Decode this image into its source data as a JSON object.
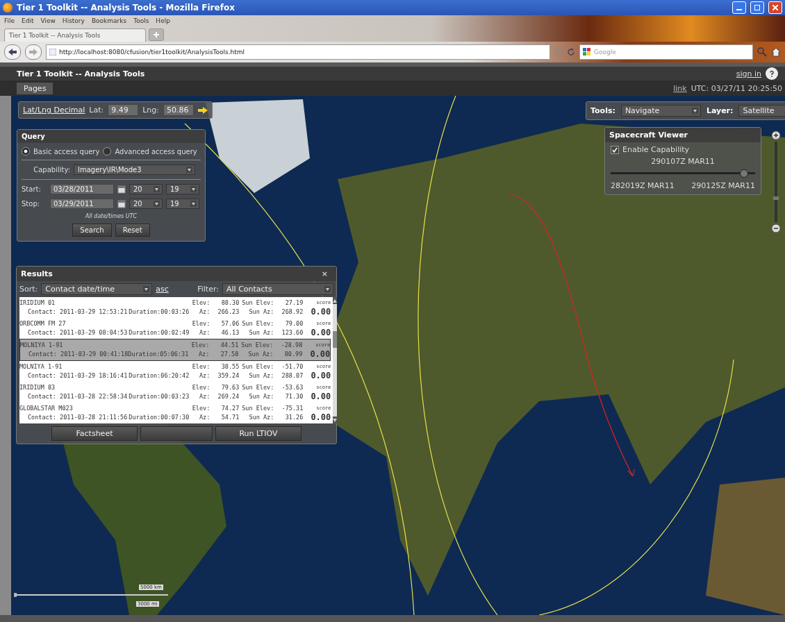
{
  "browser": {
    "title": "Tier 1 Toolkit -- Analysis Tools - Mozilla Firefox",
    "menu": [
      "File",
      "Edit",
      "View",
      "History",
      "Bookmarks",
      "Tools",
      "Help"
    ],
    "tabs": [
      {
        "label": "Tier 1 Toolkit -- Analysis Tools",
        "selected": true
      }
    ],
    "url": "http://localhost:8080/cfusion/tier1toolkit/AnalysisTools.html",
    "search_placeholder": "Google"
  },
  "app": {
    "title": "Tier 1 Toolkit -- Analysis Tools",
    "sign_in": "sign in",
    "pages": "Pages",
    "link": "link",
    "utc": "UTC: 03/27/11 20:25:50"
  },
  "coords": {
    "mode": "Lat/Lng Decimal",
    "lat_label": "Lat:",
    "lat": "9.49",
    "lng_label": "Lng:",
    "lng": "50.86"
  },
  "toolbar": {
    "tools_label": "Tools:",
    "tools": "Navigate",
    "layer_label": "Layer:",
    "layer": "Satellite"
  },
  "query": {
    "title": "Query",
    "modes": [
      {
        "label": "Basic access query",
        "selected": true
      },
      {
        "label": "Advanced access query",
        "selected": false
      }
    ],
    "capability_label": "Capability:",
    "capability": "Imagery\\IR\\Mode3",
    "start_label": "Start:",
    "start_date": "03/28/2011",
    "start_hour": "20",
    "start_minute": "19",
    "stop_label": "Stop:",
    "stop_date": "03/29/2011",
    "stop_hour": "20",
    "stop_minute": "19",
    "note": "All date/times UTC",
    "buttons": [
      "Search",
      "Reset"
    ]
  },
  "results": {
    "title": "Results",
    "close": "×",
    "sort_label": "Sort:",
    "sort": "Contact date/time",
    "order": "asc",
    "filter_label": "Filter:",
    "filter": "All Contacts",
    "rows": [
      {
        "name": "IRIDIUM 01",
        "contact": "Contact: 2011-03-29 12:53:21",
        "duration": "Duration:00:03:26",
        "elev_label": "Elev:",
        "elev": "88.30",
        "az_label": "Az:",
        "az": "266.23",
        "sun_elev_label": "Sun Elev:",
        "sun_elev": "27.19",
        "sun_az_label": "Sun Az:",
        "sun_az": "268.92",
        "score_label": "score",
        "score": "0.00",
        "selected": false
      },
      {
        "name": "ORBCOMM FM 27",
        "contact": "Contact: 2011-03-29 08:04:53",
        "duration": "Duration:00:02:49",
        "elev_label": "Elev:",
        "elev": "57.06",
        "az_label": "Az:",
        "az": "46.13",
        "sun_elev_label": "Sun Elev:",
        "sun_elev": "79.00",
        "sun_az_label": "Sun Az:",
        "sun_az": "123.60",
        "score_label": "score",
        "score": "0.00",
        "selected": false
      },
      {
        "name": "MOLNIYA 1-91",
        "contact": "Contact: 2011-03-29 00:41:18",
        "duration": "Duration:05:06:31",
        "elev_label": "Elev:",
        "elev": "44.51",
        "az_label": "Az:",
        "az": "27.58",
        "sun_elev_label": "Sun Elev:",
        "sun_elev": "-28.98",
        "sun_az_label": "Sun Az:",
        "sun_az": "80.99",
        "score_label": "score",
        "score": "0.00",
        "selected": true
      },
      {
        "name": "MOLNIYA 1-91",
        "contact": "Contact: 2011-03-29 18:16:41",
        "duration": "Duration:06:20:42",
        "elev_label": "Elev:",
        "elev": "38.55",
        "az_label": "Az:",
        "az": "359.24",
        "sun_elev_label": "Sun Elev:",
        "sun_elev": "-51.70",
        "sun_az_label": "Sun Az:",
        "sun_az": "288.07",
        "score_label": "score",
        "score": "0.00",
        "selected": false
      },
      {
        "name": "IRIDIUM 83",
        "contact": "Contact: 2011-03-28 22:58:34",
        "duration": "Duration:00:03:23",
        "elev_label": "Elev:",
        "elev": "79.63",
        "az_label": "Az:",
        "az": "269.24",
        "sun_elev_label": "Sun Elev:",
        "sun_elev": "-53.63",
        "sun_az_label": "Sun Az:",
        "sun_az": "71.30",
        "score_label": "score",
        "score": "0.00",
        "selected": false
      },
      {
        "name": "GLOBALSTAR M023",
        "contact": "Contact: 2011-03-28 21:11:56",
        "duration": "Duration:00:07:30",
        "elev_label": "Elev:",
        "elev": "74.27",
        "az_label": "Az:",
        "az": "54.71",
        "sun_elev_label": "Sun Elev:",
        "sun_elev": "-75.31",
        "sun_az_label": "Sun Az:",
        "sun_az": "31.26",
        "score_label": "score",
        "score": "0.00",
        "selected": false
      }
    ],
    "buttons": [
      "Factsheet",
      "Run LTIOV"
    ]
  },
  "spacecraft": {
    "title": "Spacecraft Viewer",
    "enable": {
      "label": "Enable Capability",
      "checked": true
    },
    "current": "290107Z MAR11",
    "level": 0.92,
    "start": "282019Z MAR11",
    "end": "290125Z MAR11"
  },
  "zoom": {
    "level": 0.3
  },
  "scale": {
    "km": "5000 km",
    "mi": "3000 mi"
  }
}
